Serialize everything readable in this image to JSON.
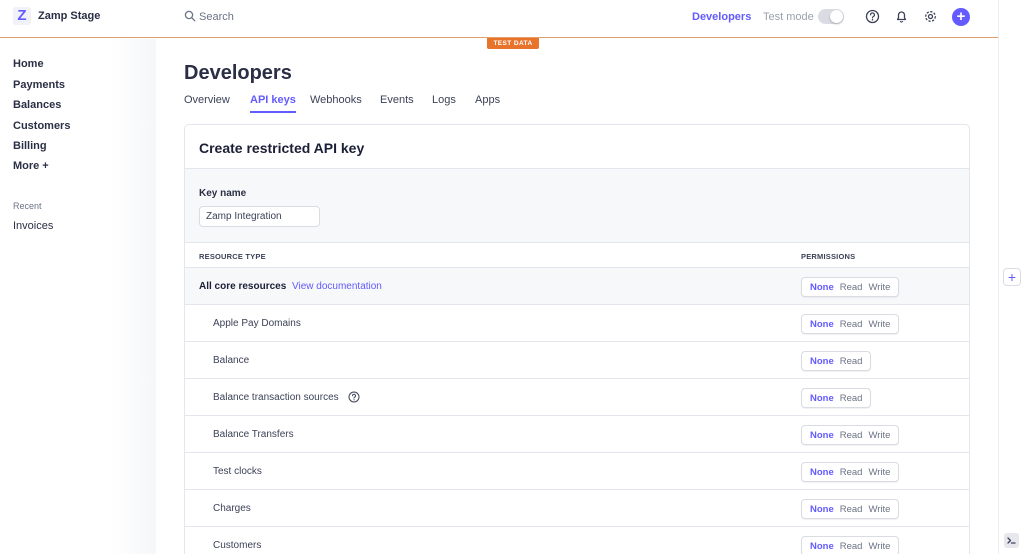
{
  "header": {
    "logo_letter": "Z",
    "account_name": "Zamp Stage",
    "search_placeholder": "Search",
    "developers_link": "Developers",
    "test_mode_label": "Test mode",
    "test_data_badge": "TEST DATA",
    "add_symbol": "+"
  },
  "sidebar": {
    "items": [
      "Home",
      "Payments",
      "Balances",
      "Customers",
      "Billing",
      "More"
    ],
    "more_symbol": "+",
    "recent_label": "Recent",
    "recent_items": [
      "Invoices"
    ]
  },
  "page": {
    "title": "Developers",
    "tabs": [
      "Overview",
      "API keys",
      "Webhooks",
      "Events",
      "Logs",
      "Apps"
    ],
    "active_tab": "API keys"
  },
  "card": {
    "title": "Create restricted API key",
    "key_name_label": "Key name",
    "key_name_value": "Zamp Integration",
    "col_resource": "RESOURCE TYPE",
    "col_permissions": "PERMISSIONS",
    "rows": [
      {
        "label": "All core resources",
        "link": "View documentation",
        "perms": [
          "None",
          "Read",
          "Write"
        ],
        "selected": "None"
      },
      {
        "label": "Apple Pay Domains",
        "perms": [
          "None",
          "Read",
          "Write"
        ],
        "selected": "None"
      },
      {
        "label": "Balance",
        "perms": [
          "None",
          "Read"
        ],
        "selected": "None"
      },
      {
        "label": "Balance transaction sources",
        "help": true,
        "perms": [
          "None",
          "Read"
        ],
        "selected": "None"
      },
      {
        "label": "Balance Transfers",
        "perms": [
          "None",
          "Read",
          "Write"
        ],
        "selected": "None"
      },
      {
        "label": "Test clocks",
        "perms": [
          "None",
          "Read",
          "Write"
        ],
        "selected": "None"
      },
      {
        "label": "Charges",
        "perms": [
          "None",
          "Read",
          "Write"
        ],
        "selected": "None"
      },
      {
        "label": "Customers",
        "perms": [
          "None",
          "Read",
          "Write"
        ],
        "selected": "None"
      }
    ]
  },
  "right_rail": {
    "add_symbol": "+"
  },
  "colors": {
    "accent": "#635bff",
    "test_badge": "#e8742c",
    "topbar_border": "#e3a06a"
  },
  "icons": [
    "search-icon",
    "help-icon",
    "bell-icon",
    "gear-icon",
    "plus-icon",
    "question-circle-icon",
    "terminal-icon"
  ]
}
